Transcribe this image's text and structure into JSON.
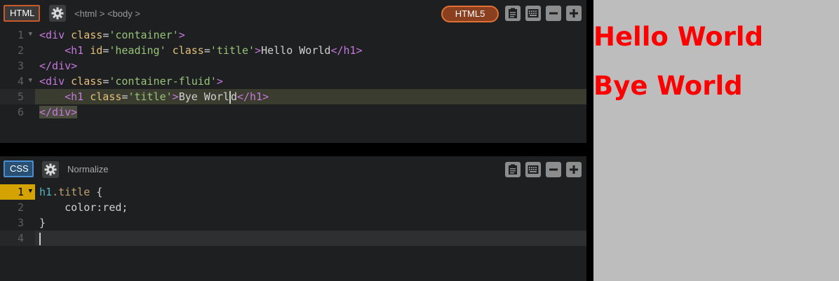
{
  "html_panel": {
    "lang_label": "HTML",
    "breadcrumb": "<html > <body >",
    "doctype_label": "HTML5",
    "lines": [
      {
        "num": "1",
        "fold": true
      },
      {
        "num": "2",
        "fold": false
      },
      {
        "num": "3",
        "fold": false
      },
      {
        "num": "4",
        "fold": true
      },
      {
        "num": "5",
        "fold": false
      },
      {
        "num": "6",
        "fold": false
      }
    ],
    "code": {
      "l1_open": "<div",
      "l1_attr": " class",
      "l1_eq": "=",
      "l1_val": "'container'",
      "l1_close": ">",
      "l2_indent": "    ",
      "l2_open": "<h1",
      "l2_attr1": " id",
      "l2_eq1": "=",
      "l2_val1": "'heading'",
      "l2_attr2": " class",
      "l2_eq2": "=",
      "l2_val2": "'title'",
      "l2_gt": ">",
      "l2_text": "Hello World",
      "l2_end": "</h1>",
      "l3": "</div>",
      "l4_open": "<div",
      "l4_attr": " class",
      "l4_eq": "=",
      "l4_val": "'container-fluid'",
      "l4_close": ">",
      "l5_indent": "    ",
      "l5_open": "<h1",
      "l5_attr": " class",
      "l5_eq": "=",
      "l5_val": "'title'",
      "l5_gt": ">",
      "l5_text1": "Bye Worl",
      "l5_text2": "d",
      "l5_end": "</h1>",
      "l6": "</div>"
    }
  },
  "css_panel": {
    "lang_label": "CSS",
    "preprocessor_label": "Normalize",
    "lines": [
      {
        "num": "1",
        "fold": true
      },
      {
        "num": "2",
        "fold": false
      },
      {
        "num": "3",
        "fold": false
      },
      {
        "num": "4",
        "fold": false
      }
    ],
    "code": {
      "l1_sel": "h1",
      "l1_cls": ".title",
      "l1_brace": " {",
      "l2": "    color:red;",
      "l3": "}"
    }
  },
  "preview": {
    "heading1": "Hello World",
    "heading2": "Bye World",
    "text_color": "#ff0000",
    "background": "#bdbdbd"
  },
  "icons": [
    "gear-icon",
    "clipboard-icon",
    "keyboard-icon",
    "minus-icon",
    "plus-icon"
  ],
  "colors": {
    "html_accent": "#c95b2b",
    "css_accent": "#4a8ed0",
    "active_line_gutter": "#d4a302"
  }
}
